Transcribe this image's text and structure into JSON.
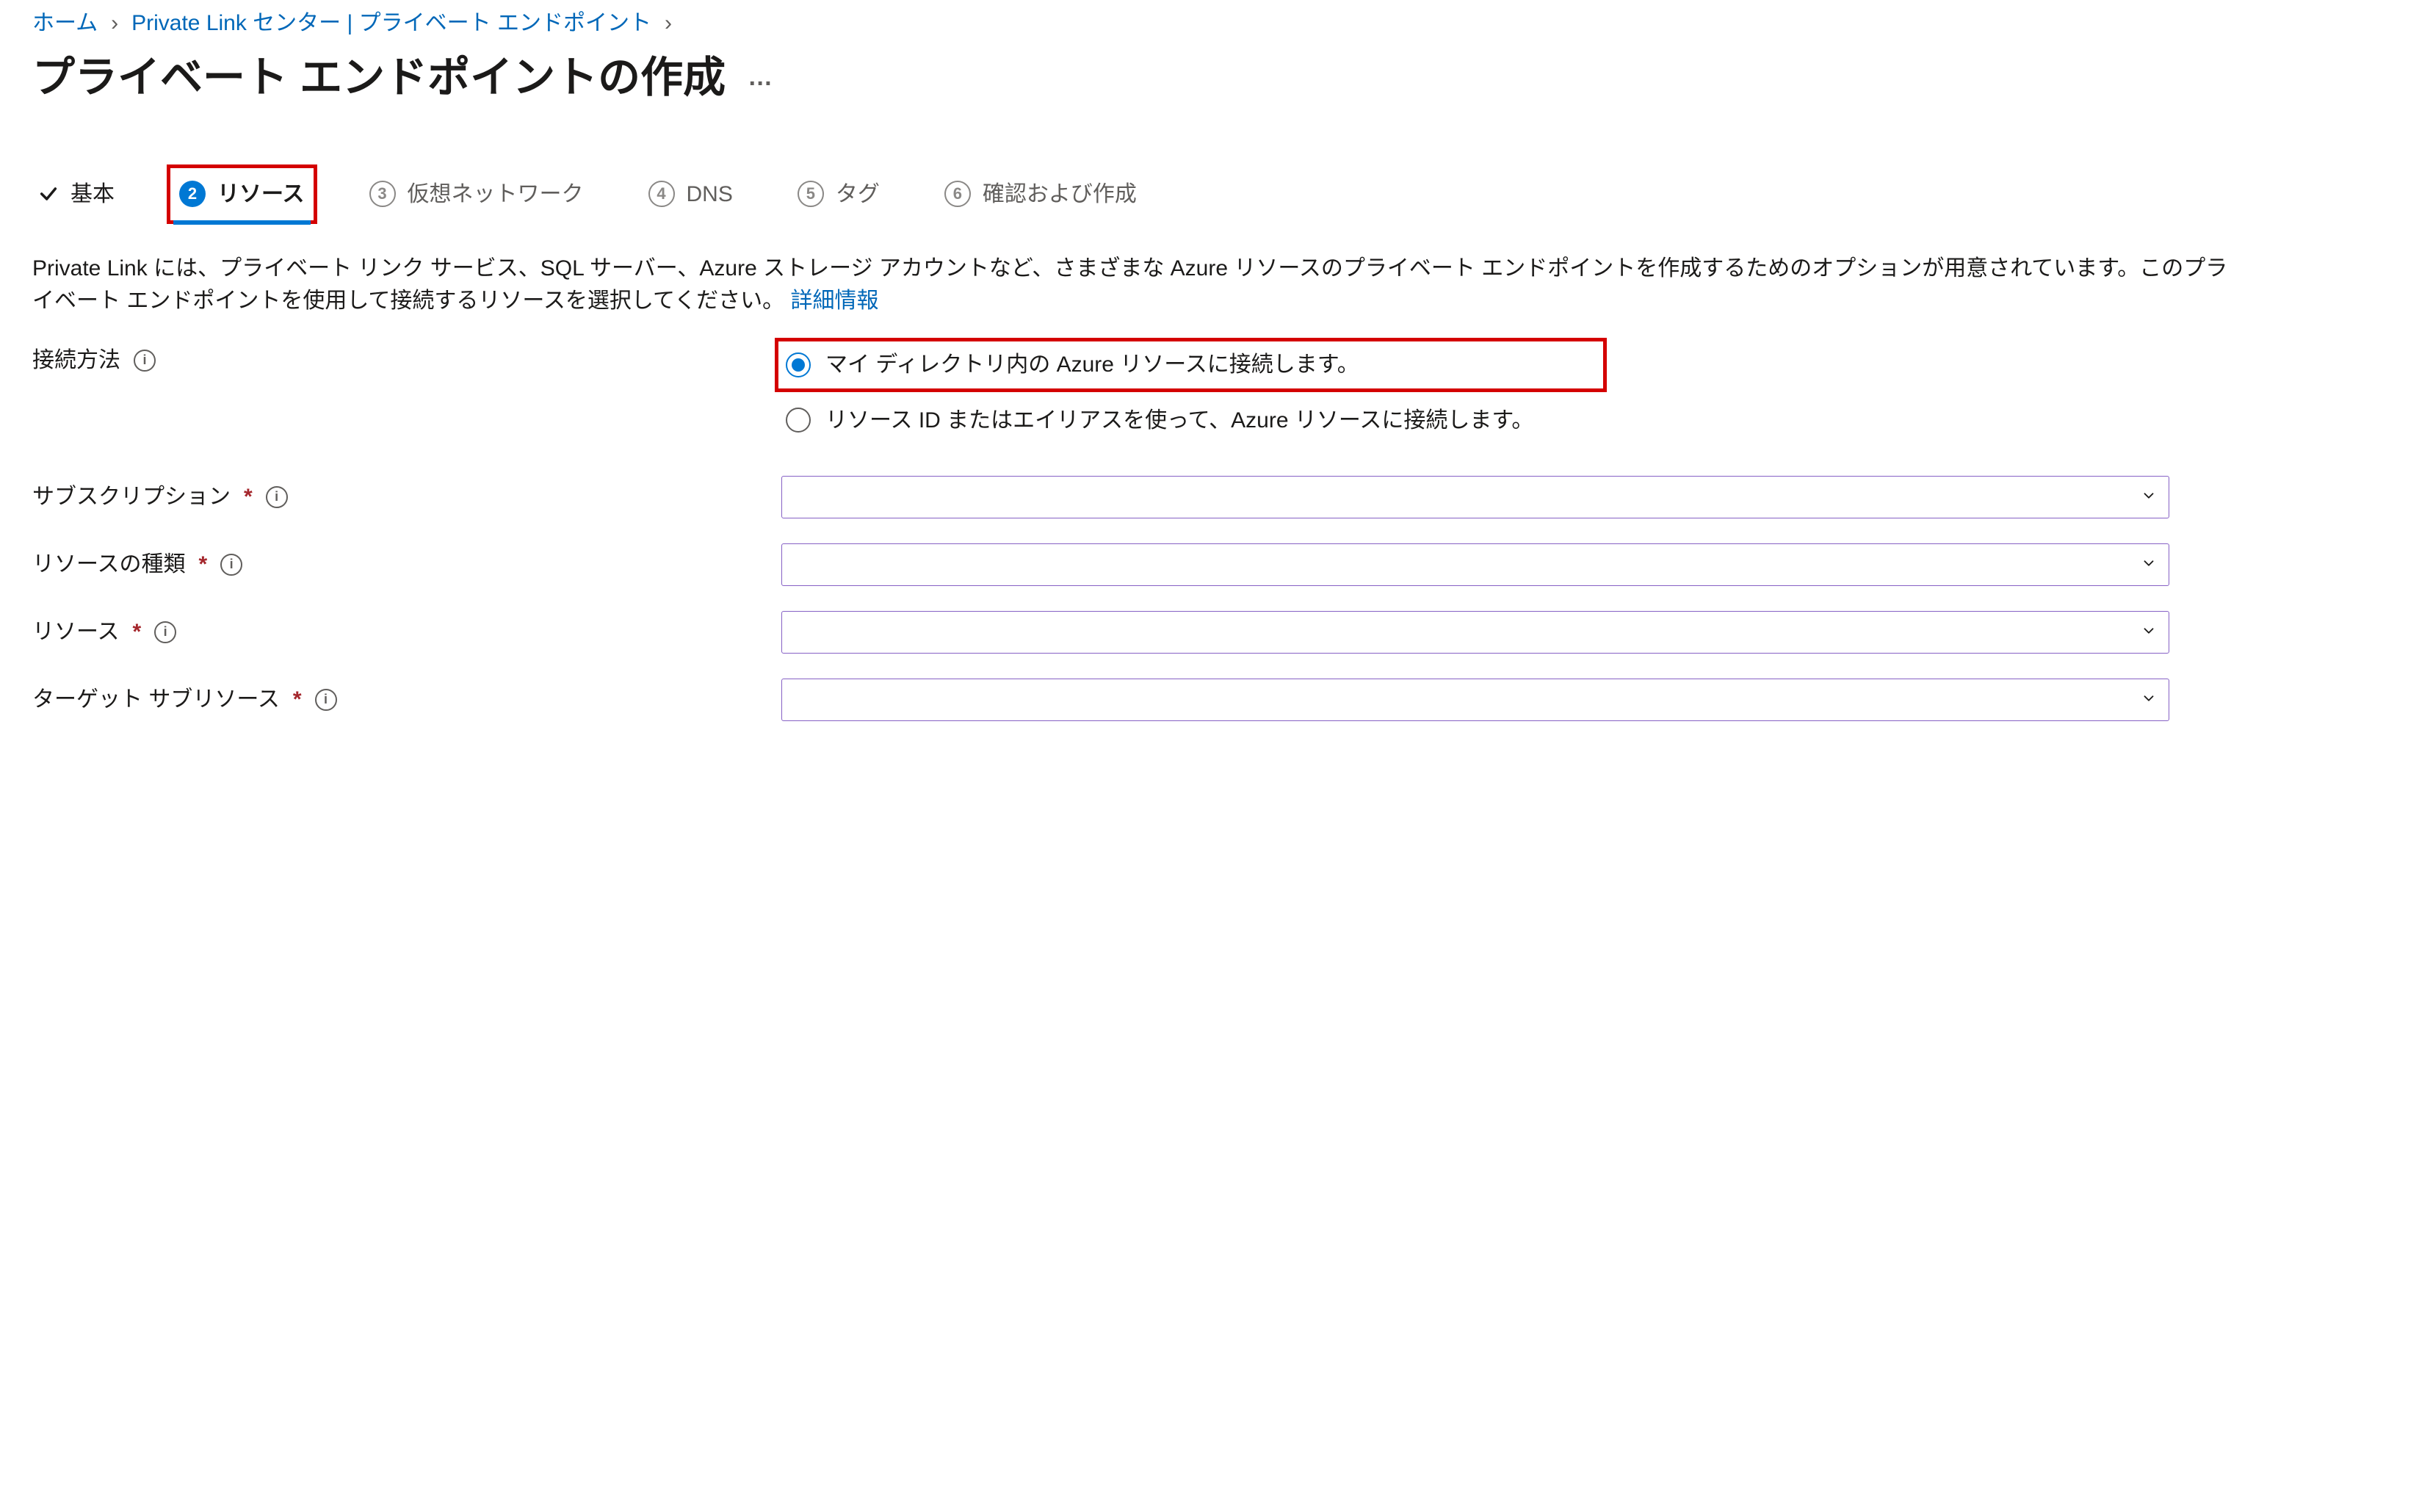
{
  "breadcrumb": {
    "home": "ホーム",
    "link": "Private Link センター | プライベート エンドポイント"
  },
  "title": "プライベート エンドポイントの作成",
  "tabs": {
    "basic": {
      "label": "基本"
    },
    "resource": {
      "label": "リソース",
      "num": "2"
    },
    "vnet": {
      "label": "仮想ネットワーク",
      "num": "3"
    },
    "dns": {
      "label": "DNS",
      "num": "4"
    },
    "tag": {
      "label": "タグ",
      "num": "5"
    },
    "review": {
      "label": "確認および作成",
      "num": "6"
    }
  },
  "intro": {
    "text": "Private Link には、プライベート リンク サービス、SQL サーバー、Azure ストレージ アカウントなど、さまざまな Azure リソースのプライベート エンドポイントを作成するためのオプションが用意されています。このプライベート エンドポイントを使用して接続するリソースを選択してください。",
    "linkText": "詳細情報"
  },
  "conn": {
    "label": "接続方法",
    "opt1": "マイ ディレクトリ内の Azure リソースに接続します。",
    "opt2": "リソース ID またはエイリアスを使って、Azure リソースに接続します。"
  },
  "fields": {
    "subscription": {
      "label": "サブスクリプション"
    },
    "resourceType": {
      "label": "リソースの種類"
    },
    "resource": {
      "label": "リソース"
    },
    "targetSub": {
      "label": "ターゲット サブリソース"
    }
  }
}
